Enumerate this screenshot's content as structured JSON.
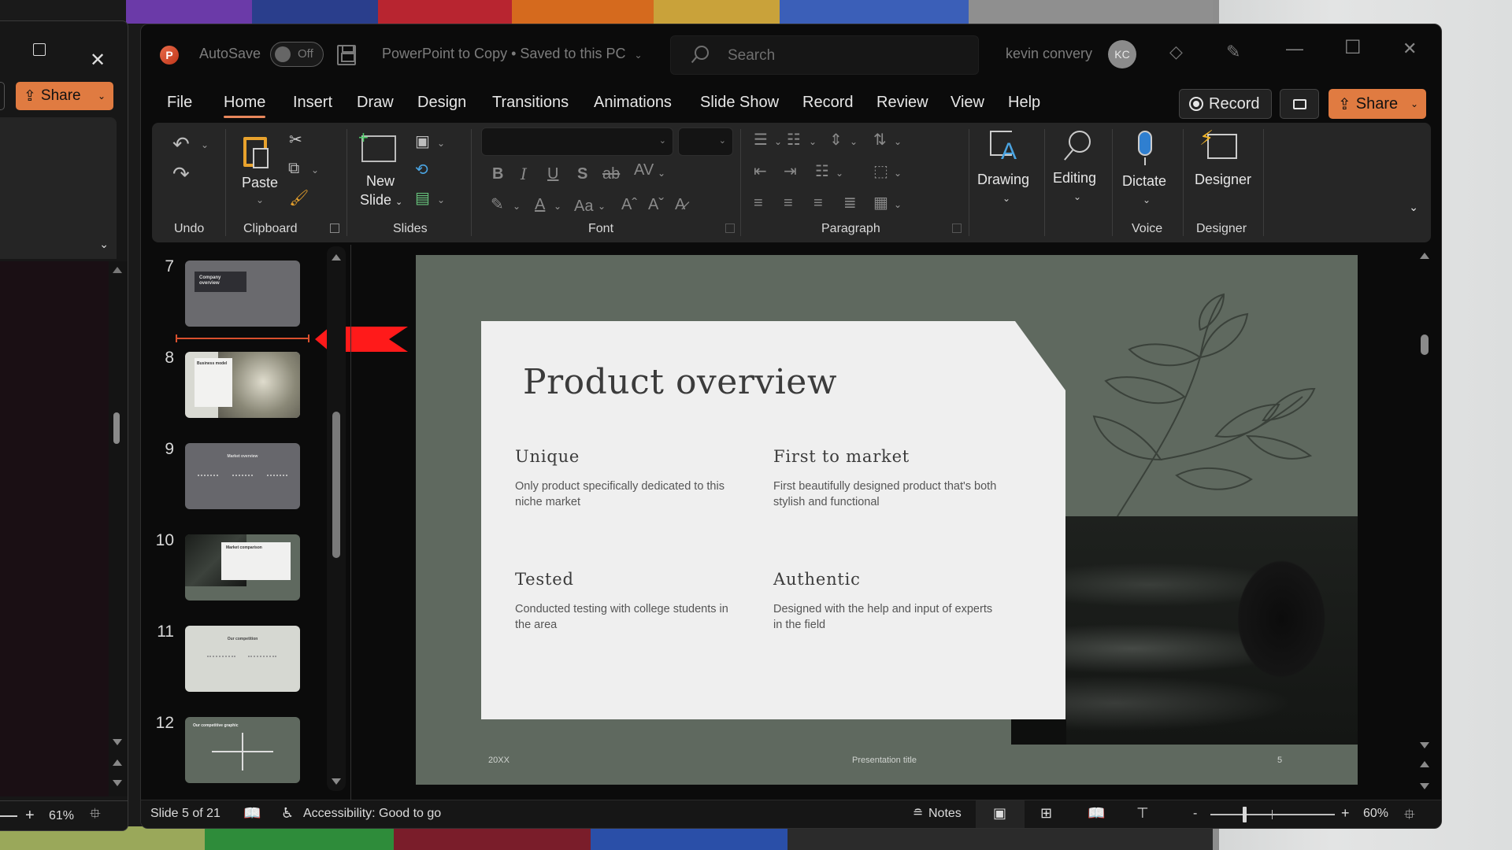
{
  "background_window": {
    "share_label": "Share",
    "zoom_level": "61%"
  },
  "titlebar": {
    "app_icon": "powerpoint-icon",
    "autosave_label": "AutoSave",
    "autosave_state": "Off",
    "document_title": "PowerPoint to Copy • Saved to this PC",
    "search_placeholder": "Search",
    "user_name": "kevin convery",
    "user_initials": "KC",
    "icons": [
      "save-icon",
      "search-icon",
      "premium-diamond-icon",
      "coauthoring-megaphone-icon",
      "minimize-icon",
      "maximize-icon",
      "close-icon"
    ]
  },
  "menu": {
    "tabs": [
      {
        "label": "File"
      },
      {
        "label": "Home",
        "active": true
      },
      {
        "label": "Insert"
      },
      {
        "label": "Draw"
      },
      {
        "label": "Design"
      },
      {
        "label": "Transitions"
      },
      {
        "label": "Animations"
      },
      {
        "label": "Slide Show"
      },
      {
        "label": "Record"
      },
      {
        "label": "Review"
      },
      {
        "label": "View"
      },
      {
        "label": "Help"
      }
    ],
    "record_button": "Record",
    "share_button": "Share",
    "accent_color": "#e07b41"
  },
  "ribbon": {
    "groups": {
      "undo": "Undo",
      "clipboard": "Clipboard",
      "slides": "Slides",
      "font": "Font",
      "paragraph": "Paragraph",
      "voice": "Voice",
      "designer": "Designer"
    },
    "buttons": {
      "paste": "Paste",
      "new_slide_line1": "New",
      "new_slide_line2": "Slide",
      "drawing": "Drawing",
      "editing": "Editing",
      "dictate": "Dictate",
      "designer": "Designer",
      "bold": "B",
      "italic": "I",
      "underline": "U",
      "shadow": "S",
      "strikethrough": "ab",
      "char_spacing": "AV",
      "font_color": "A",
      "change_case": "Aa",
      "grow_font": "Aˆ",
      "shrink_font": "Aˇ"
    },
    "font_name_value": "",
    "font_size_value": ""
  },
  "thumbnails": [
    {
      "number": "7",
      "title": "Company overview",
      "style": "dark-gray"
    },
    {
      "number": "8",
      "title": "Business model",
      "style": "light-photo"
    },
    {
      "number": "9",
      "title": "Market overview",
      "style": "gray-stats"
    },
    {
      "number": "10",
      "title": "Market comparison",
      "style": "green-photo"
    },
    {
      "number": "11",
      "title": "Our competition",
      "style": "light"
    },
    {
      "number": "12",
      "title": "Our competitive graphic",
      "style": "green-chart"
    }
  ],
  "slide": {
    "title": "Product overview",
    "blocks": [
      {
        "heading": "Unique",
        "body": "Only product specifically dedicated to this niche market"
      },
      {
        "heading": "First to market",
        "body": "First beautifully designed product that's both stylish and functional"
      },
      {
        "heading": "Tested",
        "body": "Conducted testing with college students in the area"
      },
      {
        "heading": "Authentic",
        "body": "Designed with the help and input of experts in the field"
      }
    ],
    "footer_left": "20XX",
    "footer_center": "Presentation title",
    "footer_right": "5",
    "background_color": "#5f695f"
  },
  "statusbar": {
    "slide_info": "Slide 5 of 21",
    "accessibility": "Accessibility: Good to go",
    "notes_label": "Notes",
    "zoom_level": "60%",
    "zoom_minus": "-",
    "zoom_plus": "+"
  }
}
